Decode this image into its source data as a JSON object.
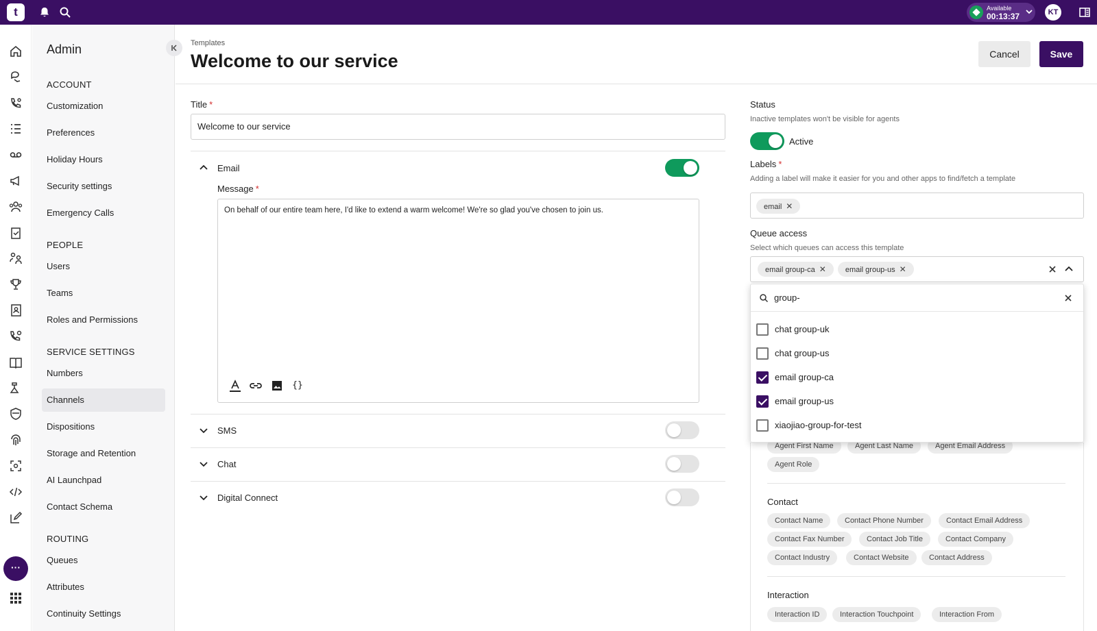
{
  "topbar": {
    "logo_letter": "t",
    "status_label": "Available",
    "status_timer": "00:13:37",
    "avatar_initials": "KT",
    "colors": {
      "brand": "#3a0f63",
      "available": "#19a05a"
    }
  },
  "sidebar": {
    "title": "Admin",
    "sections": {
      "account": "ACCOUNT",
      "people": "PEOPLE",
      "service": "SERVICE SETTINGS",
      "routing": "ROUTING"
    },
    "items": {
      "customization": "Customization",
      "preferences": "Preferences",
      "holiday_hours": "Holiday Hours",
      "security": "Security settings",
      "emergency": "Emergency Calls",
      "users": "Users",
      "teams": "Teams",
      "roles": "Roles and Permissions",
      "numbers": "Numbers",
      "channels": "Channels",
      "dispositions": "Dispositions",
      "storage": "Storage and Retention",
      "ai": "AI Launchpad",
      "schema": "Contact Schema",
      "queues": "Queues",
      "attributes": "Attributes",
      "continuity": "Continuity Settings"
    },
    "active_item": "Channels"
  },
  "header": {
    "breadcrumb": "Templates",
    "title": "Welcome to our service",
    "cancel_label": "Cancel",
    "save_label": "Save"
  },
  "form": {
    "title_label": "Title",
    "title_value": "Welcome to our service",
    "email_label": "Email",
    "message_label": "Message",
    "message_value": "On behalf of our entire team here, I'd like to extend a warm welcome! We're so glad you've chosen to join us.",
    "sms_label": "SMS",
    "chat_label": "Chat",
    "digital_label": "Digital Connect",
    "toggles": {
      "email": true,
      "sms": false,
      "chat": false,
      "digital": false
    }
  },
  "right": {
    "status_label": "Status",
    "status_help": "Inactive templates won't be visible for agents",
    "status_value": "Active",
    "labels_label": "Labels",
    "labels_help": "Adding a label will make it easier for you and other apps to find/fetch a template",
    "labels_chips": [
      "email"
    ],
    "queue_label": "Queue access",
    "queue_help": "Select which queues can access this template",
    "queue_chips": [
      "email group-ca",
      "email group-us"
    ],
    "search_value": "group-",
    "options": [
      {
        "label": "chat group-uk",
        "checked": false
      },
      {
        "label": "chat group-us",
        "checked": false
      },
      {
        "label": "email group-ca",
        "checked": true
      },
      {
        "label": "email group-us",
        "checked": true
      },
      {
        "label": "xiaojiao-group-for-test",
        "checked": false
      }
    ],
    "agent_vars": [
      "Agent First Name",
      "Agent Last Name",
      "Agent Email Address",
      "Agent Role"
    ],
    "contact_heading": "Contact",
    "contact_vars": [
      "Contact Name",
      "Contact Phone Number",
      "Contact Email Address",
      "Contact Fax Number",
      "Contact Job Title",
      "Contact Company",
      "Contact Industry",
      "Contact Website",
      "Contact Address"
    ],
    "interaction_heading": "Interaction",
    "interaction_vars": [
      "Interaction ID",
      "Interaction Touchpoint",
      "Interaction From"
    ]
  }
}
